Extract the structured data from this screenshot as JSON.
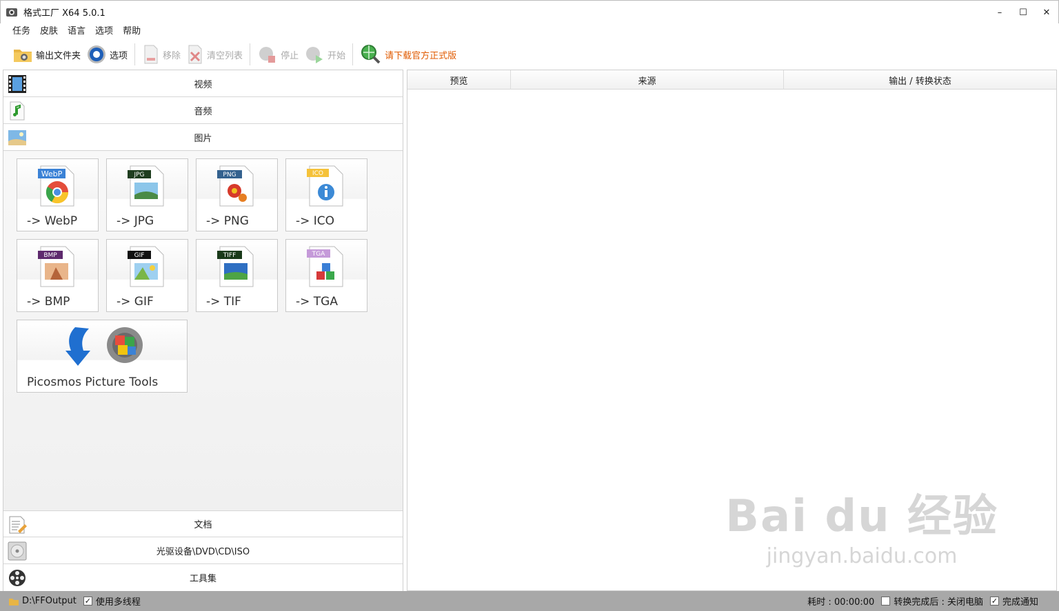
{
  "window": {
    "title": "格式工厂 X64 5.0.1",
    "minimize": "–",
    "maximize": "☐",
    "close": "✕"
  },
  "menu": [
    "任务",
    "皮肤",
    "语言",
    "选项",
    "帮助"
  ],
  "toolbar": {
    "output_folder": "输出文件夹",
    "options": "选项",
    "remove": "移除",
    "clear_list": "清空列表",
    "stop": "停止",
    "start": "开始",
    "download": "请下载官方正式版"
  },
  "categories": {
    "video": "视频",
    "audio": "音频",
    "image": "图片",
    "document": "文档",
    "disc": "光驱设备\\DVD\\CD\\ISO",
    "tools": "工具集"
  },
  "formats": {
    "webp": {
      "label": "-> WebP",
      "badge": "WebP"
    },
    "jpg": {
      "label": "-> JPG",
      "badge": "JPG"
    },
    "png": {
      "label": "-> PNG",
      "badge": "PNG"
    },
    "ico": {
      "label": "-> ICO",
      "badge": "ICO"
    },
    "bmp": {
      "label": "-> BMP",
      "badge": "BMP"
    },
    "gif": {
      "label": "-> GIF",
      "badge": "GIF"
    },
    "tif": {
      "label": "-> TIF",
      "badge": "TIFF"
    },
    "tga": {
      "label": "-> TGA",
      "badge": "TGA"
    },
    "picosmos": {
      "label": "Picosmos Picture Tools"
    }
  },
  "task_table": {
    "columns": [
      "预览",
      "来源",
      "输出 / 转换状态"
    ]
  },
  "statusbar": {
    "output_path": "D:\\FFOutput",
    "multithread": "使用多线程",
    "elapsed": "耗时 : 00:00:00",
    "after_done": "转换完成后 : 关闭电脑",
    "notify": "完成通知"
  },
  "watermark": {
    "main": "Bai du 经验",
    "sub": "jingyan.baidu.com"
  },
  "colors": {
    "accent_link": "#e05a00",
    "statusbar_bg": "#a8a8a8"
  }
}
